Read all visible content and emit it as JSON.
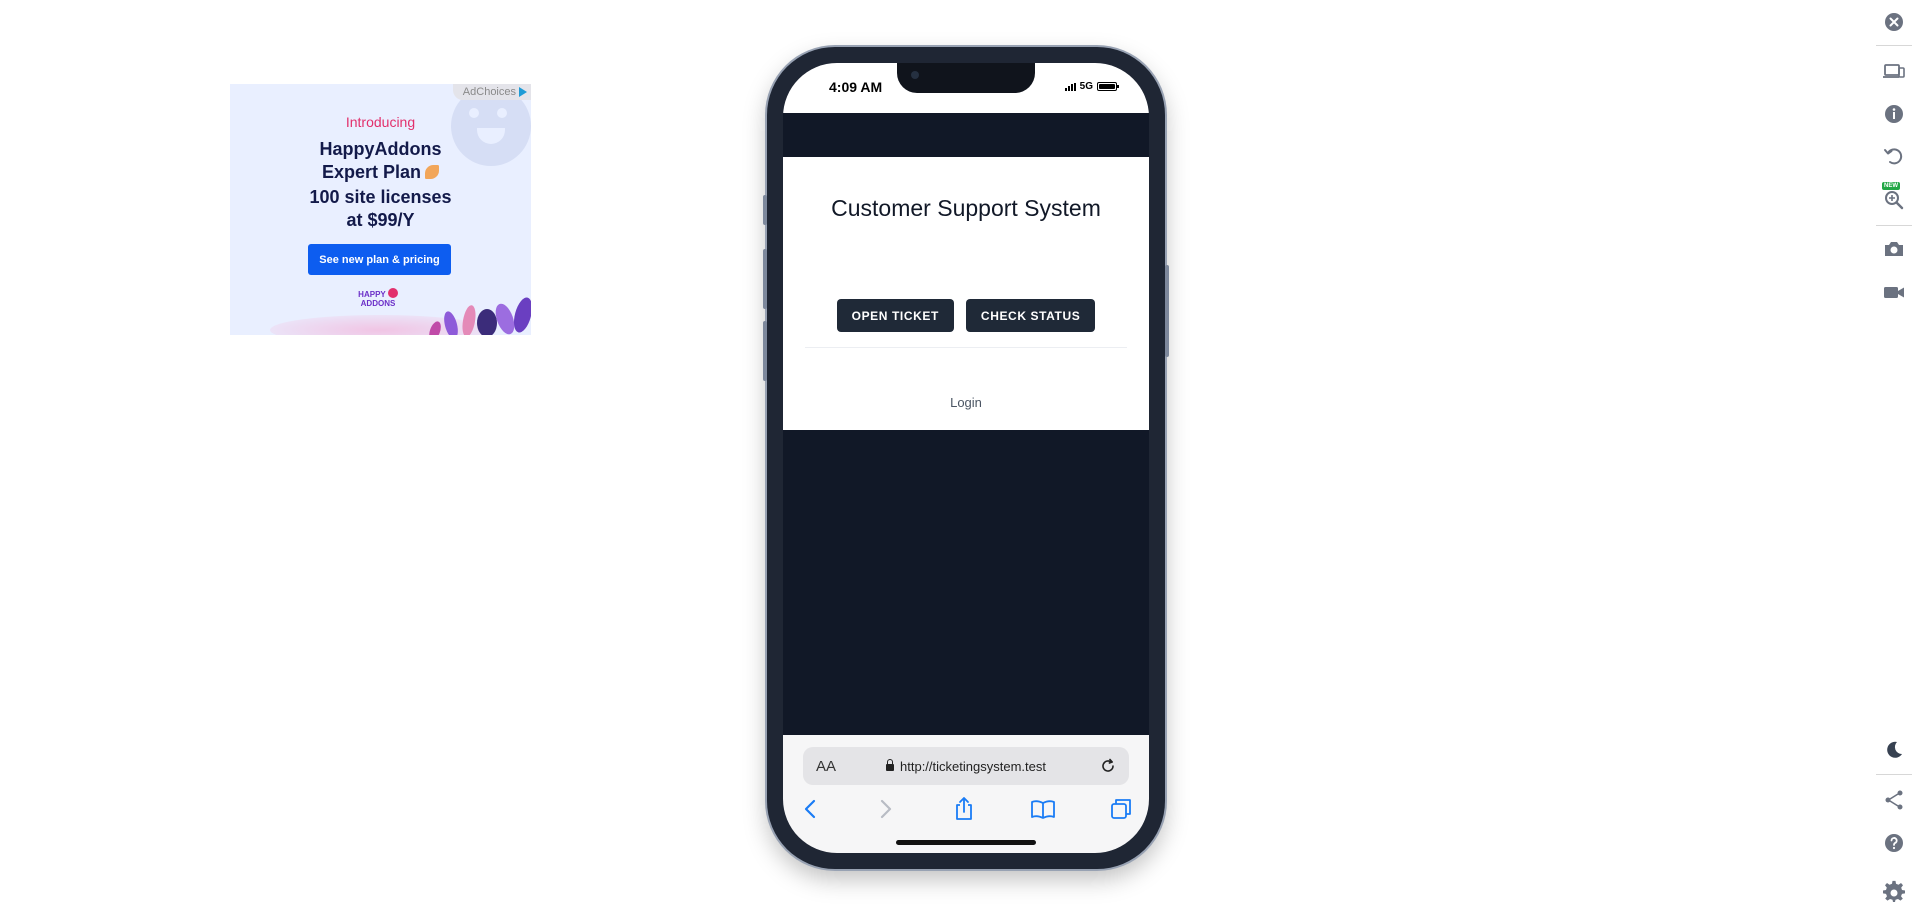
{
  "ad": {
    "adchoices_label": "AdChoices",
    "intro": "Introducing",
    "headline_1": "HappyAddons",
    "headline_2": "Expert Plan",
    "subline_1": "100 site licenses",
    "subline_2": "at $99/Y",
    "cta_label": "See new plan & pricing",
    "logo_line_1": "HAPPY",
    "logo_line_2": "ADDONS"
  },
  "phone": {
    "status": {
      "time": "4:09 AM",
      "network": "5G"
    },
    "page": {
      "title": "Customer Support System",
      "open_ticket_label": "OPEN TICKET",
      "check_status_label": "CHECK STATUS",
      "login_label": "Login"
    },
    "browser": {
      "text_size_label": "AA",
      "url": "http://ticketingsystem.test",
      "toolbar": [
        "back-icon",
        "forward-icon",
        "share-icon",
        "bookmarks-icon",
        "tabs-icon"
      ]
    }
  },
  "sidebar": {
    "new_badge": "NEW",
    "icons": [
      "close-icon",
      "devices-icon",
      "info-icon",
      "rotate-icon",
      "zoom-icon",
      "screenshot-icon",
      "video-icon",
      "dark-mode-icon",
      "share-icon",
      "help-icon",
      "settings-icon"
    ]
  },
  "colors": {
    "page_bg": "#111827",
    "button_bg": "#1f2937",
    "ad_cta": "#0d5df0",
    "ad_intro": "#e2306c",
    "safari_blue": "#1a7cf5"
  }
}
